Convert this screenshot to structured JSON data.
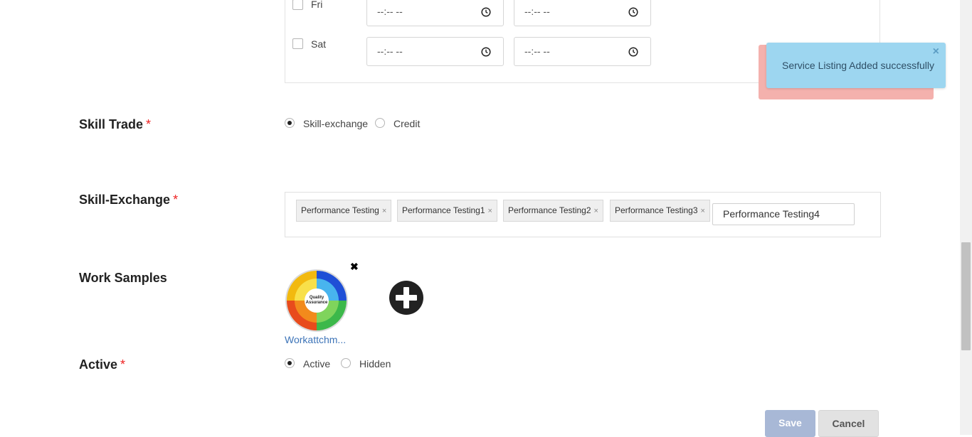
{
  "schedule": {
    "days": [
      {
        "label": "Fri",
        "start": "--:-- --",
        "end": "--:-- --"
      },
      {
        "label": "Sat",
        "start": "--:-- --",
        "end": "--:-- --"
      }
    ]
  },
  "skill_trade": {
    "label": "Skill Trade",
    "required": "*",
    "options": [
      "Skill-exchange",
      "Credit"
    ],
    "selected": "Skill-exchange"
  },
  "skill_exchange": {
    "label": "Skill-Exchange",
    "required": "*",
    "tags": [
      "Performance Testing",
      "Performance Testing1",
      "Performance Testing2",
      "Performance Testing3"
    ],
    "tag_remove": "×",
    "input_value": "Performance Testing4"
  },
  "work_samples": {
    "label": "Work Samples",
    "caption": "Workattchm...",
    "remove": "✖",
    "image_text": [
      "Quality",
      "Assurance"
    ]
  },
  "active": {
    "label": "Active",
    "required": "*",
    "options": [
      "Active",
      "Hidden"
    ],
    "selected": "Active"
  },
  "actions": {
    "save": "Save",
    "cancel": "Cancel"
  },
  "toast": {
    "message": "Service Listing Added successfully",
    "close": "×"
  },
  "icons": {
    "clock": "clock-icon",
    "add": "plus-circle-icon",
    "close": "close-icon"
  },
  "colors": {
    "accent_link": "#3d74b8",
    "toast_bg": "#9dd6f0",
    "error_bg": "#f4b1ad",
    "required": "#e22222"
  }
}
